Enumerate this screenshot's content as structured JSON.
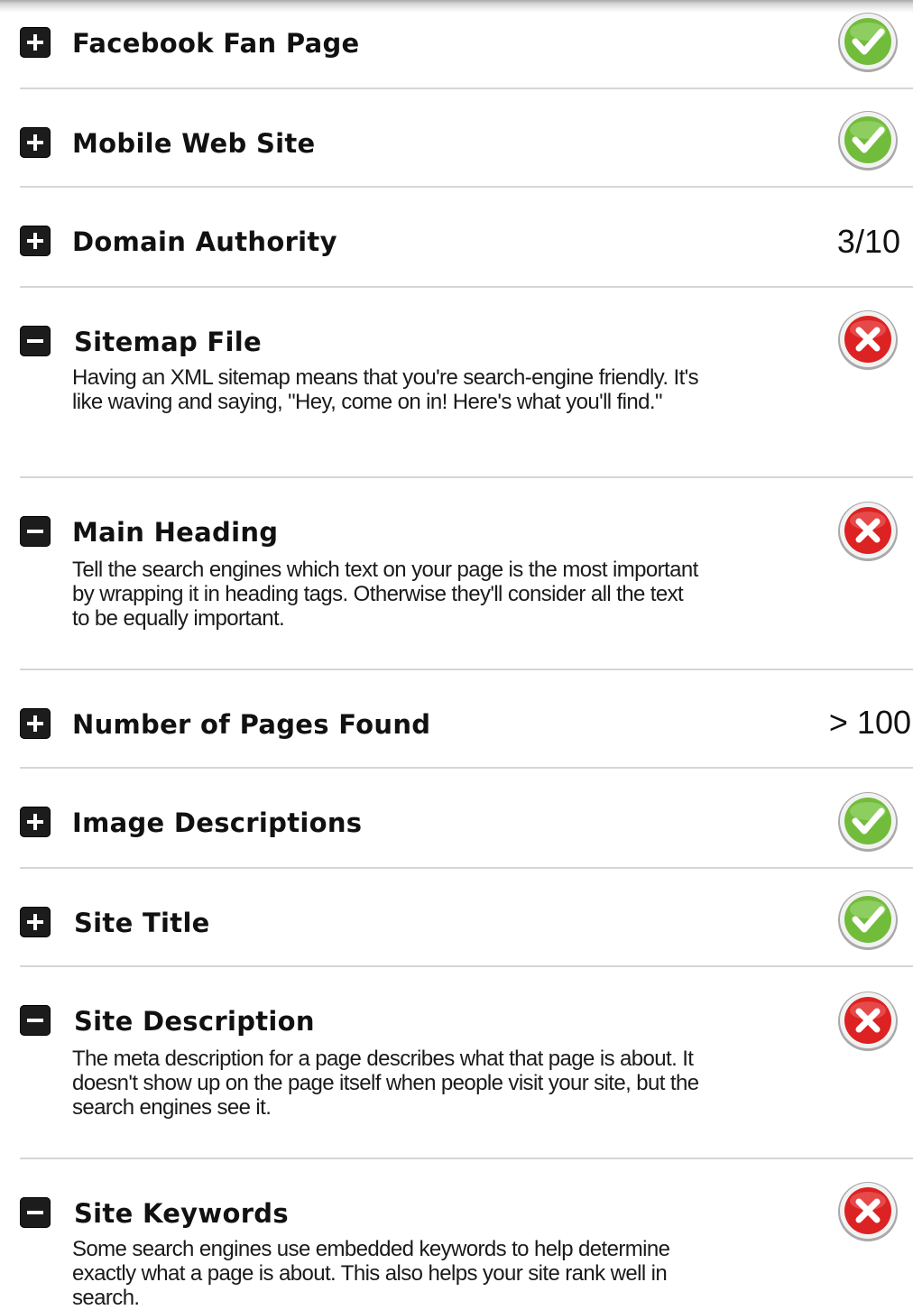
{
  "items": [
    {
      "title": "Facebook Fan Page",
      "expanded": false,
      "status": "pass"
    },
    {
      "title": "Mobile Web Site",
      "expanded": false,
      "status": "pass"
    },
    {
      "title": "Domain Authority",
      "expanded": false,
      "status": "value",
      "value": "3/10"
    },
    {
      "title": "Sitemap File",
      "expanded": true,
      "status": "fail",
      "description": "Having an XML sitemap means that you're search-engine friendly. It's like waving and saying, \"Hey, come on in! Here's what you'll find.\""
    },
    {
      "title": "Main Heading",
      "expanded": true,
      "status": "fail",
      "description": "Tell the search engines which text on your page is the most important by wrapping it in heading tags. Otherwise they'll consider all the text to be equally important."
    },
    {
      "title": "Number of Pages Found",
      "expanded": false,
      "status": "value",
      "value": "> 100"
    },
    {
      "title": "Image Descriptions",
      "expanded": false,
      "status": "pass"
    },
    {
      "title": "Site Title",
      "expanded": false,
      "status": "pass"
    },
    {
      "title": "Site Description",
      "expanded": true,
      "status": "fail",
      "description": "The meta description for a page describes what that page is about. It doesn't show up on the page itself when people visit your site, but the search engines see it."
    },
    {
      "title": "Site Keywords",
      "expanded": true,
      "status": "fail",
      "description": "Some search engines use embedded keywords to help determine exactly what a page is about. This also helps your site rank well in search."
    }
  ],
  "colors": {
    "pass": "#7cc342",
    "fail": "#e02626",
    "divider": "#d6d6d6",
    "toggle": "#1c1c1c"
  },
  "icons": {
    "expand": "plus-icon",
    "collapse": "minus-icon",
    "pass": "check-circle-icon",
    "fail": "x-circle-icon"
  }
}
